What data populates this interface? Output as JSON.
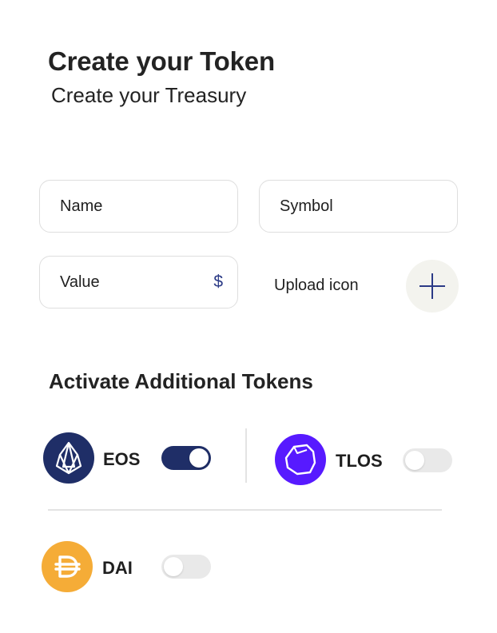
{
  "header": {
    "title": "Create your Token",
    "subtitle": "Create your Treasury"
  },
  "form": {
    "name_placeholder": "Name",
    "symbol_placeholder": "Symbol",
    "value_placeholder": "Value",
    "currency_symbol": "$",
    "upload_label": "Upload icon"
  },
  "tokens_section": {
    "title": "Activate Additional Tokens",
    "tokens": [
      {
        "label": "EOS",
        "icon": "eos-icon",
        "color": "#1f2e67",
        "enabled": true
      },
      {
        "label": "TLOS",
        "icon": "telos-icon",
        "color": "#571aff",
        "enabled": false
      },
      {
        "label": "DAI",
        "icon": "dai-icon",
        "color": "#f5ac37",
        "enabled": false
      }
    ]
  },
  "colors": {
    "accent": "#1f2e67",
    "toggle_off": "#e9e9e9",
    "border": "#dedede"
  }
}
